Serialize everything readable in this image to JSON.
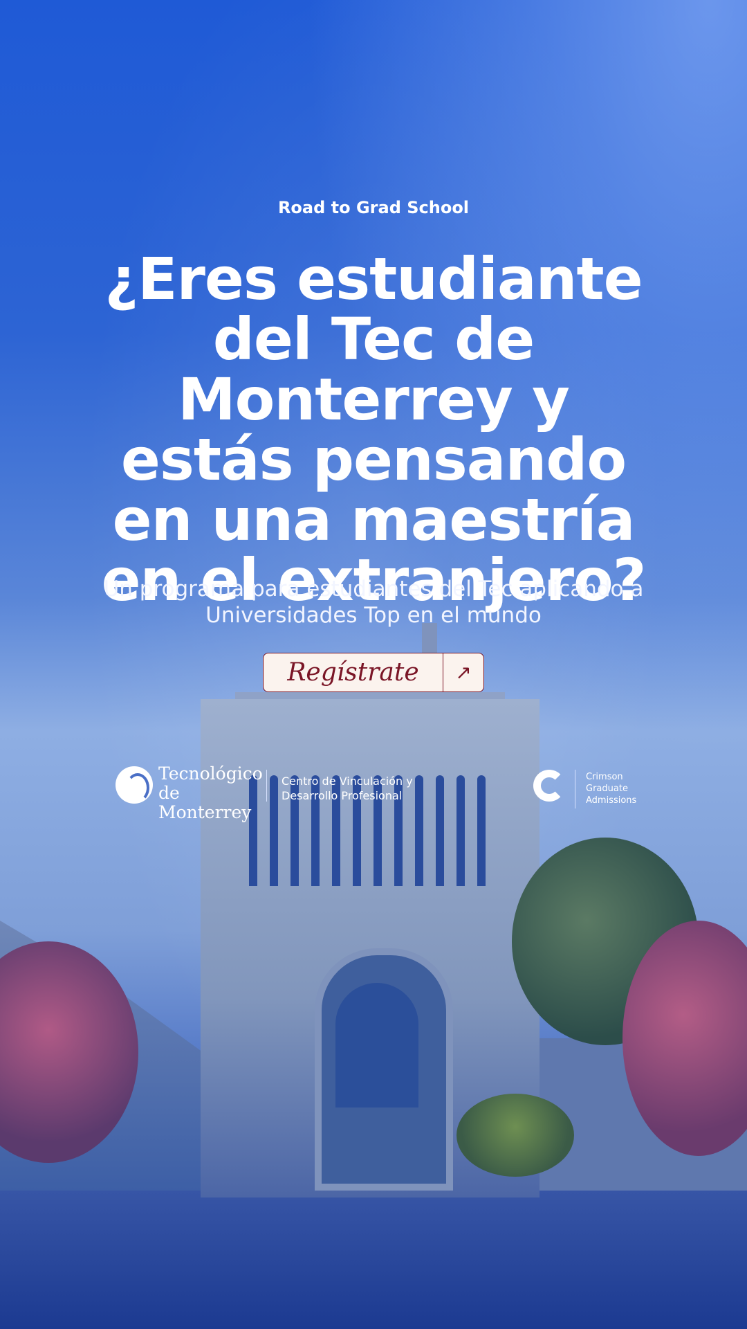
{
  "eyebrow": "Road to Grad School",
  "headline": "¿Eres estudiante del Tec de Monterrey y estás pensando en una maestría en el extranjero?",
  "subtitle": "Un programa para estudiantes del Tec  aplicando a Universidades Top en el mundo",
  "cta": {
    "label": "Regístrate",
    "arrow": "↗"
  },
  "logos": {
    "tec_name": "Tecnológico de Monterrey",
    "tec_dept": "Centro de Vinculación y Desarrollo Profesional",
    "crimson": "Crimson Graduate Admissions"
  },
  "colors": {
    "accent": "#7a1526",
    "background": "#2d64d4"
  }
}
